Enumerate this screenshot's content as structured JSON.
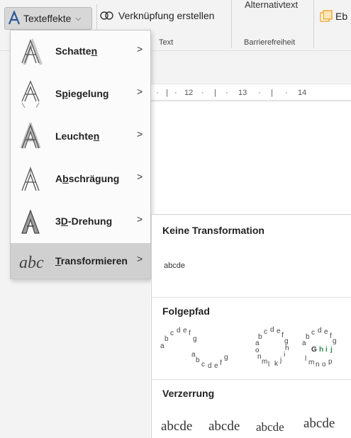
{
  "ribbon": {
    "texteffekte_label": "Texteffekte",
    "verknuepfung_label": "Verknüpfung erstellen",
    "alternativtext_label": "Alternativtext",
    "ebene_label": "Eb",
    "group_text": "Text",
    "group_barrierefreiheit": "Barrierefreiheit",
    "accent_blue": "#2b579a",
    "accent_orange": "#f0a830"
  },
  "ruler": {
    "ticks": [
      "12",
      "13",
      "14"
    ]
  },
  "menu": {
    "items": [
      {
        "pre": "Schatte",
        "u": "n",
        "post": "",
        "icon": "shadow-a-icon"
      },
      {
        "pre": "S",
        "u": "p",
        "post": "iegelung",
        "icon": "reflection-a-icon"
      },
      {
        "pre": "Leuchte",
        "u": "n",
        "post": "",
        "icon": "glow-a-icon"
      },
      {
        "pre": "A",
        "u": "b",
        "post": "schrägung",
        "icon": "bevel-a-icon"
      },
      {
        "pre": "3",
        "u": "D",
        "post": "-Drehung",
        "icon": "rotation-3d-a-icon"
      },
      {
        "pre": "",
        "u": "T",
        "post": "ransformieren",
        "icon": "transform-abc-icon"
      }
    ],
    "arrow": ">"
  },
  "submenu": {
    "keine_transformation": "Keine Transformation",
    "abcde_plain": "abcde",
    "folgepfad": "Folgepfad",
    "verzerrung": "Verzerrung",
    "warp_samples": [
      "abcde",
      "abcde",
      "abcde",
      "abcde"
    ]
  }
}
